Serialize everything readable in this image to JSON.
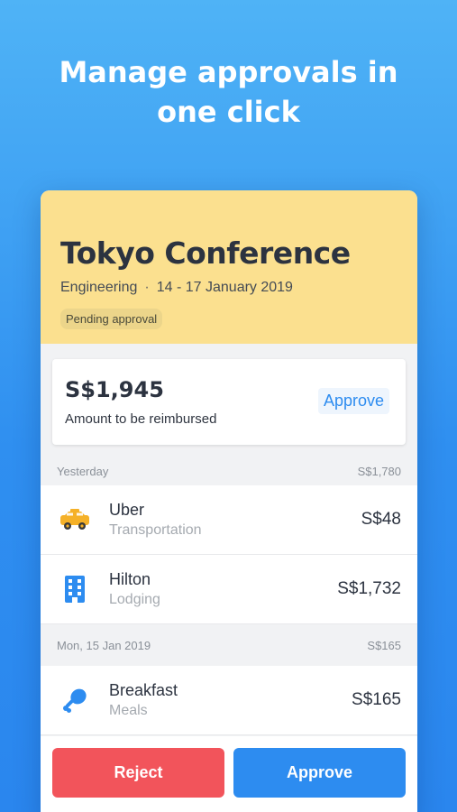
{
  "promo": {
    "headline_line1": "Manage approvals in",
    "headline_line2": "one click"
  },
  "trip": {
    "title": "Tokyo Conference",
    "department": "Engineering",
    "separator": "·",
    "dates": "14 - 17 January 2019",
    "status": "Pending approval"
  },
  "summary": {
    "amount": "S$1,945",
    "label": "Amount to be reimbursed",
    "approve_label": "Approve"
  },
  "sections": [
    {
      "date": "Yesterday",
      "total": "S$1,780",
      "items": [
        {
          "name": "Uber",
          "category": "Transportation",
          "amount": "S$48",
          "icon": "taxi-icon"
        },
        {
          "name": "Hilton",
          "category": "Lodging",
          "amount": "S$1,732",
          "icon": "building-icon"
        }
      ]
    },
    {
      "date": "Mon, 15 Jan 2019",
      "total": "S$165",
      "items": [
        {
          "name": "Breakfast",
          "category": "Meals",
          "amount": "S$165",
          "icon": "drumstick-icon"
        }
      ]
    }
  ],
  "actions": {
    "reject_label": "Reject",
    "approve_label": "Approve"
  },
  "colors": {
    "header_bg": "#fbe08f",
    "primary": "#2d8cf0",
    "danger": "#f2545b",
    "taxi": "#f5b128"
  }
}
